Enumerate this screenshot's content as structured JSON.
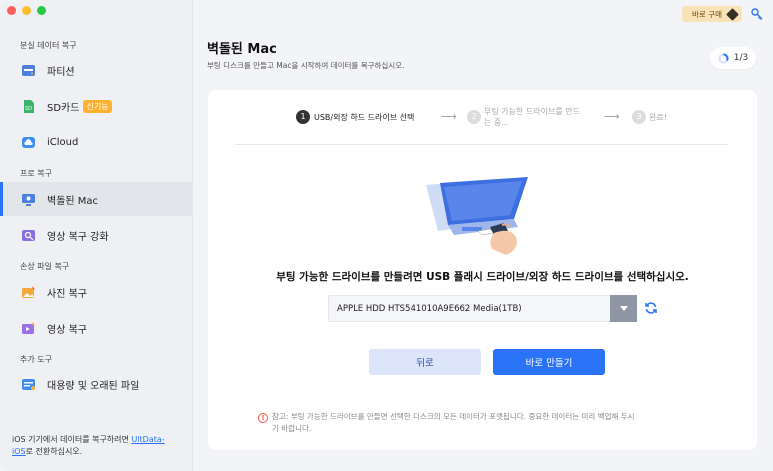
{
  "sidebar": {
    "section1": "분실 데이터 복구",
    "partition": "파티션",
    "sdcard": "SD카드",
    "sdcard_badge": "신기능",
    "icloud": "iCloud",
    "section2": "프로 복구",
    "crashed_mac": "벽돌된 Mac",
    "video_enhance": "영상 복구 강화",
    "section3": "손상 파일 복구",
    "photo_repair": "사진 복구",
    "video_repair": "영상 복구",
    "section4": "추가 도구",
    "large_files": "대용량 및 오래된 파일",
    "footer_text1": "iOS 기기에서 데이터를 복구하려면 ",
    "footer_link1": "UltData-",
    "footer_link2": "iOS",
    "footer_text2": "로 전환하십시오."
  },
  "header": {
    "buy_label": "바로 구매",
    "title": "벽돌된 Mac",
    "subtitle": "부팅 디스크를 만들고 Mac을 시작하여 데이터를 복구하십시오.",
    "progress": "1/3"
  },
  "steps": {
    "step1_num": "1",
    "step1_label": "USB/외장 하드 드라이브 선택",
    "step2_num": "2",
    "step2_label_line1": "부팅 가능한 드라이브를 만드",
    "step2_label_line2": "는 중...",
    "step3_num": "3",
    "step3_label": "완료!"
  },
  "content": {
    "instruction": "부팅 가능한 드라이브를 만들려면 USB 플래시 드라이브/외장 하드 드라이브를 선택하십시오.",
    "drive_selected": "APPLE HDD HTS541010A9E662 Media(1TB)",
    "back_label": "뒤로",
    "create_label": "바로 만들기",
    "note_line1": "참고: 부팅 가능한 드라이브를 만들면 선택한 디스크의 모든 데이터가 포맷됩니다. 중요한 데이터는 미리 백업해 두시",
    "note_line2": "기 바랍니다."
  },
  "colors": {
    "accent": "#2a72f6",
    "badge": "#ffb02e",
    "warning": "#ee5544"
  }
}
